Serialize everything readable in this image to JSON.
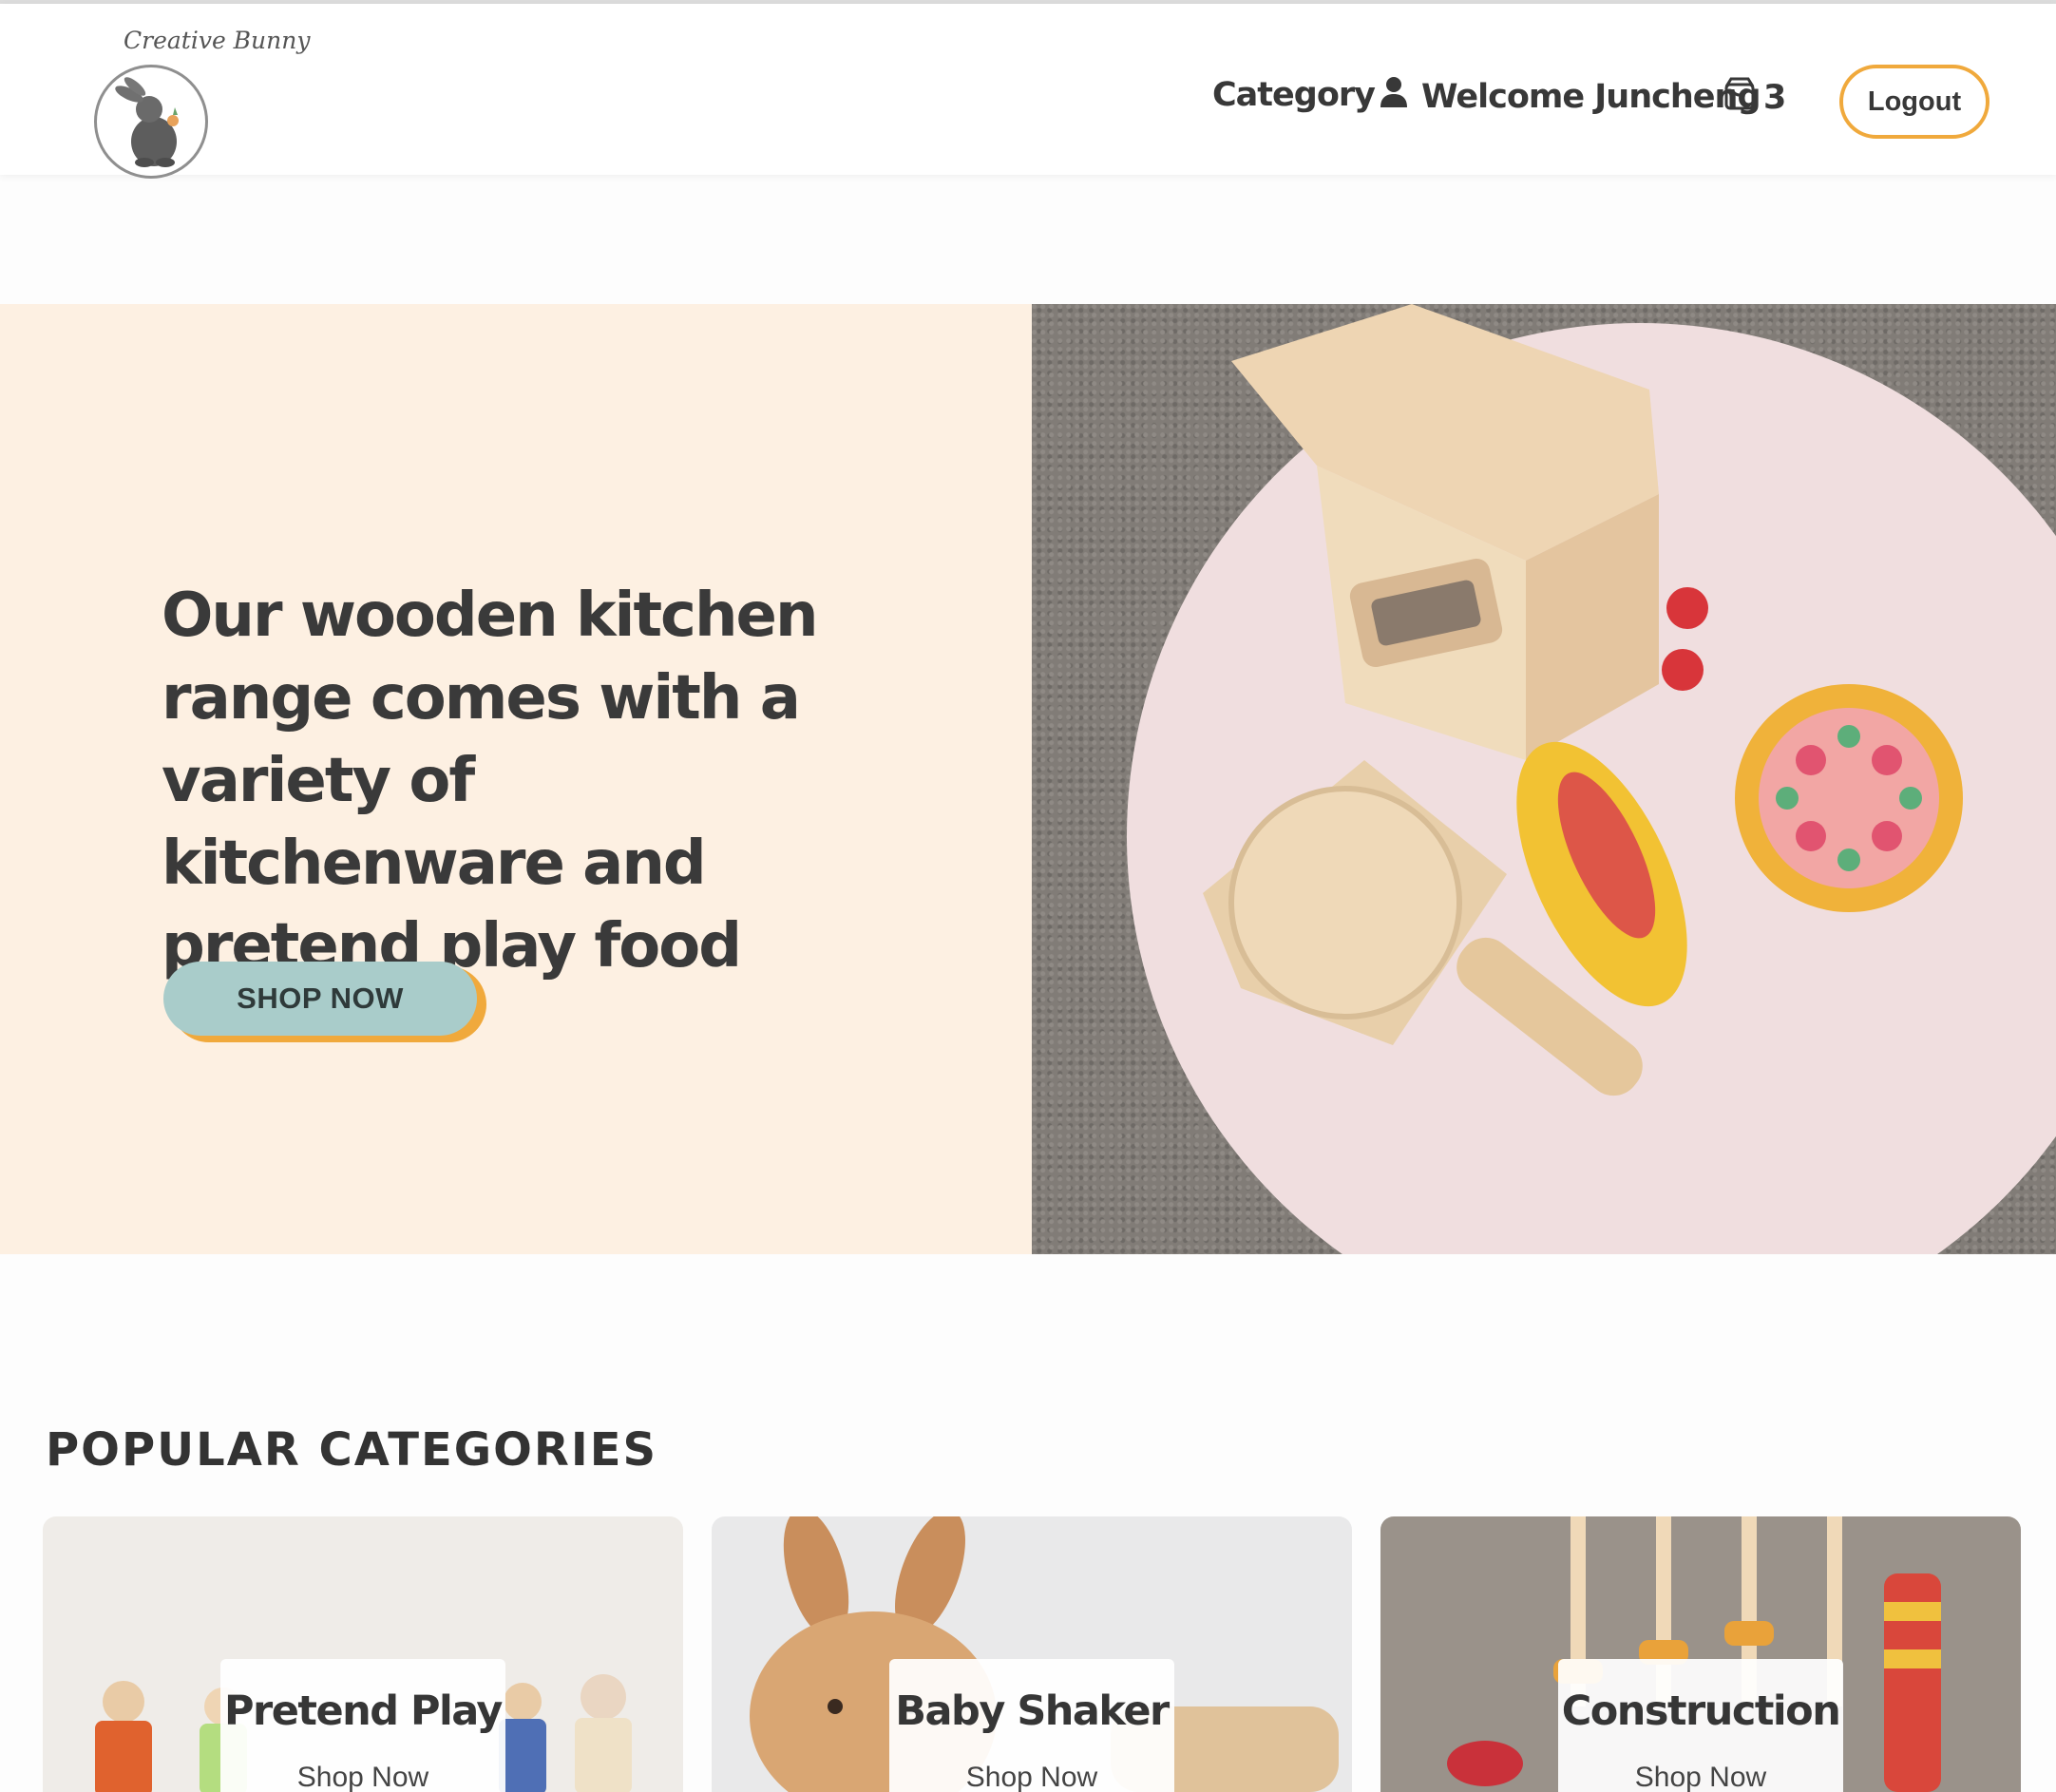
{
  "brand": {
    "logo_text": "Creative Bunny"
  },
  "nav": {
    "category": "Category",
    "welcome": "Welcome Juncheng",
    "cart_count": "3",
    "logout": "Logout"
  },
  "hero": {
    "title": "Our wooden kitchen range comes with a variety of kitchenware and pretend play food",
    "cta": "SHOP NOW",
    "image_alt": "wooden toy oven, pizza peel, bread and pizza on a pink board"
  },
  "popular": {
    "title": "POPULAR CATEGORIES",
    "categories": [
      {
        "label": "Pretend Play",
        "sub": "Shop Now"
      },
      {
        "label": "Baby Shaker",
        "sub": "Shop Now"
      },
      {
        "label": "Construction",
        "sub": "Shop Now"
      }
    ]
  },
  "colors": {
    "accent": "#f0a93c",
    "cta": "#a9ccca",
    "hero_bg": "#fdf0e2",
    "text": "#383838"
  }
}
